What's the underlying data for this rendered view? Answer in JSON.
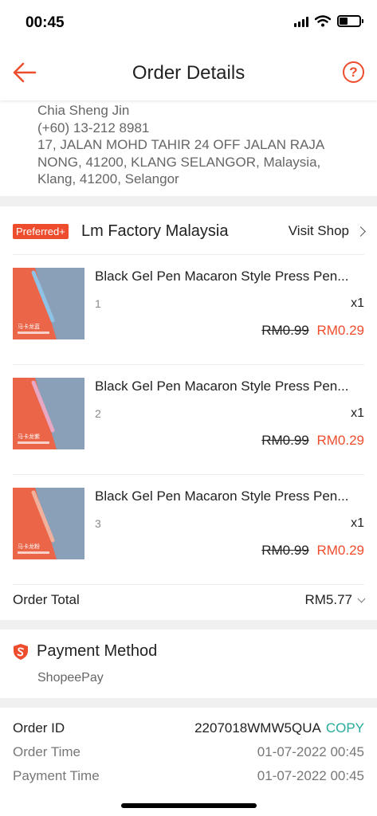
{
  "status_bar": {
    "time": "00:45"
  },
  "header": {
    "title": "Order Details",
    "help_glyph": "?",
    "back_icon": "arrow-left-icon",
    "help_icon": "question-circle-icon"
  },
  "address": {
    "name": "Chia Sheng Jin",
    "phone": "(+60) 13-212 8981",
    "line1": "17, JALAN MOHD TAHIR 24 OFF JALAN RAJA",
    "line2": "NONG, 41200, KLANG SELANGOR, Malaysia,",
    "line3": "Klang, 41200, Selangor"
  },
  "shop": {
    "badge": "Preferred+",
    "name": "Lm Factory Malaysia",
    "visit_label": "Visit Shop"
  },
  "products": [
    {
      "title": "Black Gel Pen Macaron Style Press Pen...",
      "variation": "1",
      "qty": "x1",
      "original_price": "RM0.99",
      "price": "RM0.29",
      "pen_color": "#8fc3e6"
    },
    {
      "title": "Black Gel Pen Macaron Style Press Pen...",
      "variation": "2",
      "qty": "x1",
      "original_price": "RM0.99",
      "price": "RM0.29",
      "pen_color": "#e8a8c4"
    },
    {
      "title": "Black Gel Pen Macaron Style Press Pen...",
      "variation": "3",
      "qty": "x1",
      "original_price": "RM0.99",
      "price": "RM0.29",
      "pen_color": "#f0b09c"
    }
  ],
  "order_total": {
    "label": "Order Total",
    "value": "RM5.77"
  },
  "payment": {
    "title": "Payment Method",
    "method": "ShopeePay",
    "icon": "shield-s-icon"
  },
  "order_info": {
    "order_id_label": "Order ID",
    "order_id": "2207018WMW5QUA",
    "copy_label": "COPY",
    "order_time_label": "Order Time",
    "order_time": "01-07-2022 00:45",
    "payment_time_label": "Payment Time",
    "payment_time": "01-07-2022 00:45"
  },
  "colors": {
    "brand": "#ee4d2d",
    "copy": "#26aa99",
    "background": "#f0f0f0"
  }
}
